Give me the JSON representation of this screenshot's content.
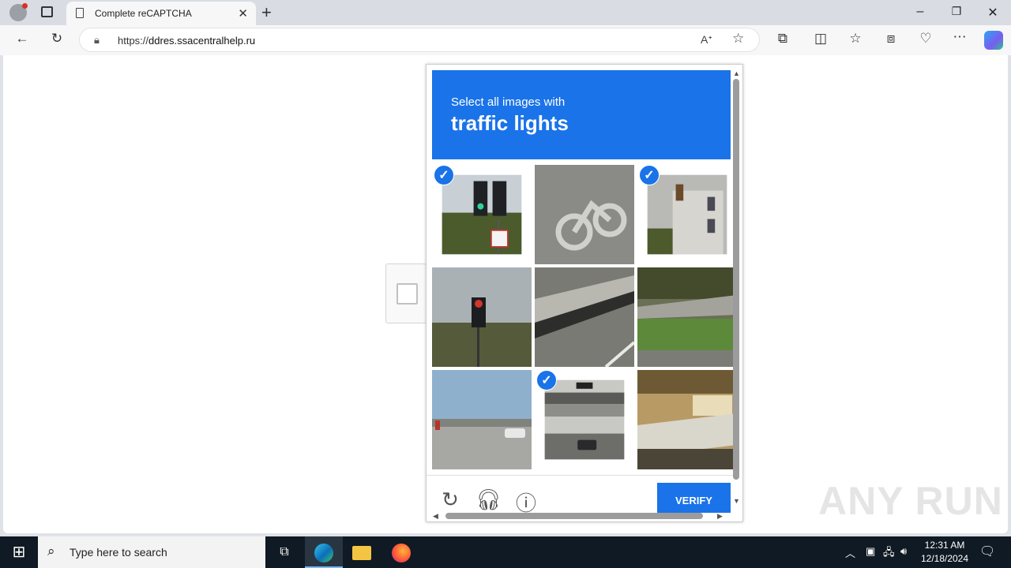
{
  "browser": {
    "tab_title": "Complete reCAPTCHA",
    "url_scheme": "https://",
    "url_host": "ddres.ssacentralhelp.ru"
  },
  "captcha": {
    "instruction": "Select all images with",
    "target": "traffic lights",
    "verify_label": "VERIFY",
    "tiles": [
      {
        "id": "tile-1",
        "selected": true,
        "scene": "traffic-light-green"
      },
      {
        "id": "tile-2",
        "selected": false,
        "scene": "bike-lane"
      },
      {
        "id": "tile-3",
        "selected": true,
        "scene": "building-with-signal"
      },
      {
        "id": "tile-4",
        "selected": false,
        "scene": "traffic-light-red"
      },
      {
        "id": "tile-5",
        "selected": false,
        "scene": "road-barrier"
      },
      {
        "id": "tile-6",
        "selected": false,
        "scene": "grass-roadside"
      },
      {
        "id": "tile-7",
        "selected": false,
        "scene": "highway"
      },
      {
        "id": "tile-8",
        "selected": true,
        "scene": "overpass-street"
      },
      {
        "id": "tile-9",
        "selected": false,
        "scene": "hillside-bus"
      }
    ]
  },
  "taskbar": {
    "search_placeholder": "Type here to search",
    "time": "12:31 AM",
    "date": "12/18/2024"
  },
  "watermark": "ANY RUN",
  "colors": {
    "accent": "#1a73e8",
    "taskbar": "#101a24"
  }
}
